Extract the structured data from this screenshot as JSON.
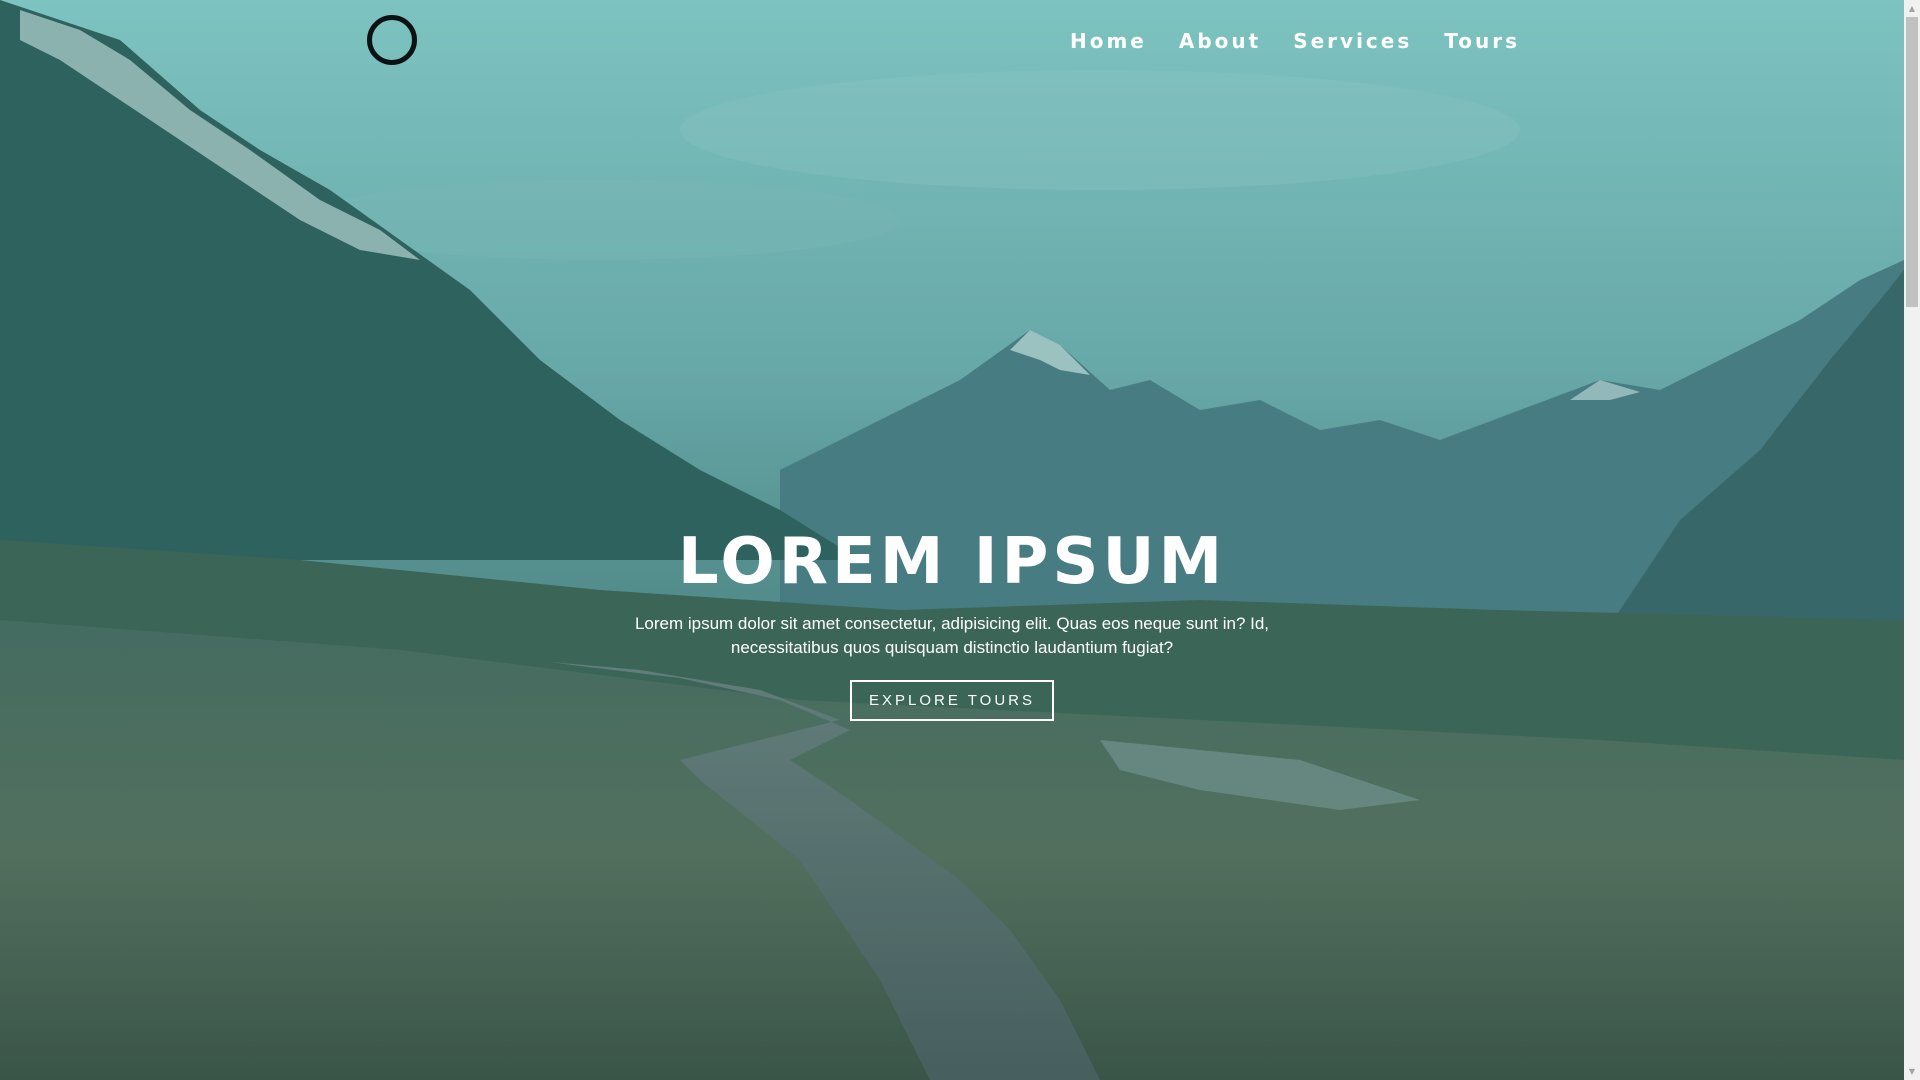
{
  "nav": {
    "items": [
      {
        "label": "Home"
      },
      {
        "label": "About"
      },
      {
        "label": "Services"
      },
      {
        "label": "Tours"
      }
    ]
  },
  "hero": {
    "title": "LOREM IPSUM",
    "text": "Lorem ipsum dolor sit amet consectetur, adipisicing elit. Quas eos neque sunt in? Id, necessitatibus quos quisquam distinctio laudantium fugiat?",
    "button_label": "EXPLORE TOURS"
  },
  "icons": {
    "logo": "circle-logo-icon",
    "scroll_up": "chevron-up-icon",
    "scroll_down": "chevron-down-icon"
  },
  "colors": {
    "overlay": "#3fa7a7",
    "text": "#ffffff",
    "logo_ring": "#0b1214"
  }
}
